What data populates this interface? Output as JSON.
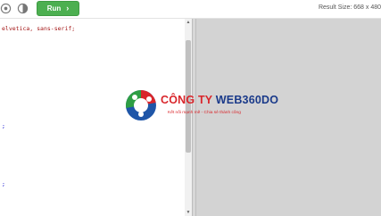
{
  "toolbar": {
    "run_label": "Run",
    "result_size": "Result Size: 668 x 480"
  },
  "editor": {
    "lines": [
      {
        "text": "elvetica, sans-serif;"
      },
      {
        "text": ";"
      },
      {
        "text": ";"
      }
    ]
  },
  "watermark": {
    "title_1": "CÔNG TY ",
    "title_2": "WEB360DO",
    "tagline": "Kết nối mạnh mẽ - Chia sẻ thành công"
  },
  "colors": {
    "run_button": "#4caf50",
    "result_bg": "#d3d3d3",
    "code_string": "#a31515",
    "code_punct": "#0000cd",
    "brand_red": "#d9262b",
    "brand_navy": "#1a3a8a",
    "brand_green": "#2e9e44",
    "brand_blue": "#1f56a8"
  },
  "icons": [
    "settings-icon",
    "contrast-icon",
    "chevron-right-icon",
    "scroll-up-icon",
    "scroll-down-icon"
  ]
}
